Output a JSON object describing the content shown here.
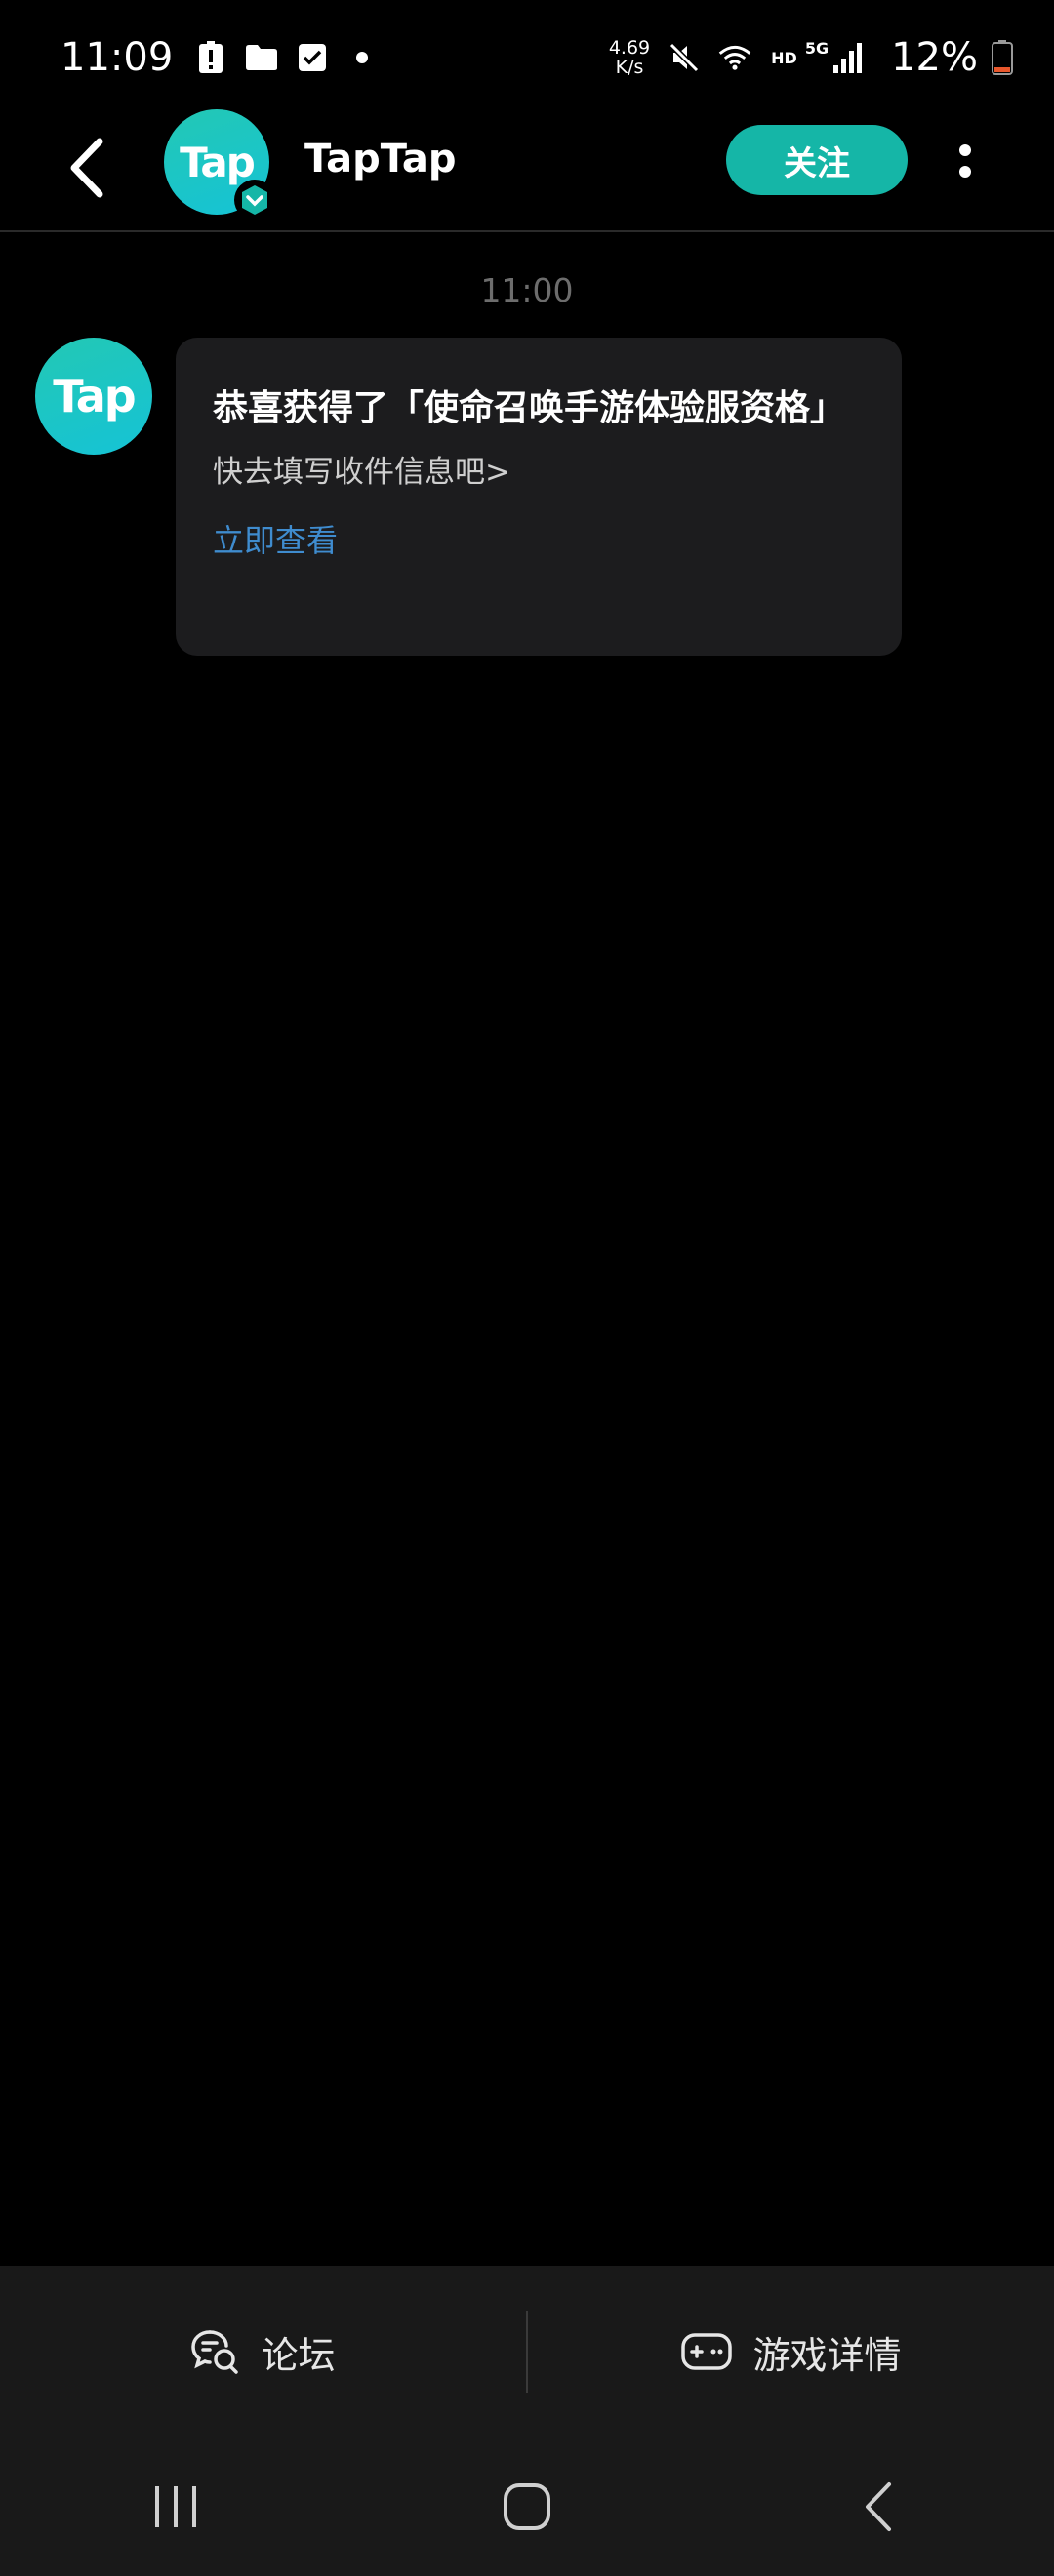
{
  "status_bar": {
    "time": "11:09",
    "net_speed_value": "4.69",
    "net_speed_unit": "K/s",
    "hd_label": "HD",
    "network_label": "5G",
    "battery": "12%",
    "icons": [
      "alert-icon",
      "folder-icon",
      "checkbox-icon",
      "dot-icon",
      "mute-icon",
      "wifi-icon",
      "signal-icon",
      "battery-icon"
    ]
  },
  "header": {
    "title": "TapTap",
    "avatar_text": "Tap",
    "follow_label": "关注"
  },
  "chat": {
    "timestamp": "11:00",
    "message": {
      "sender_avatar_text": "Tap",
      "title": "恭喜获得了「使命召唤手游体验服资格」",
      "subtitle": "快去填写收件信息吧>",
      "link": "立即查看"
    }
  },
  "bottom_tabs": [
    {
      "label": "论坛",
      "icon": "forum-icon"
    },
    {
      "label": "游戏详情",
      "icon": "gamepad-icon"
    }
  ],
  "colors": {
    "accent": "#15b6a7",
    "link": "#3f8ccf",
    "bubble": "#1c1c1e",
    "background": "#000000"
  }
}
